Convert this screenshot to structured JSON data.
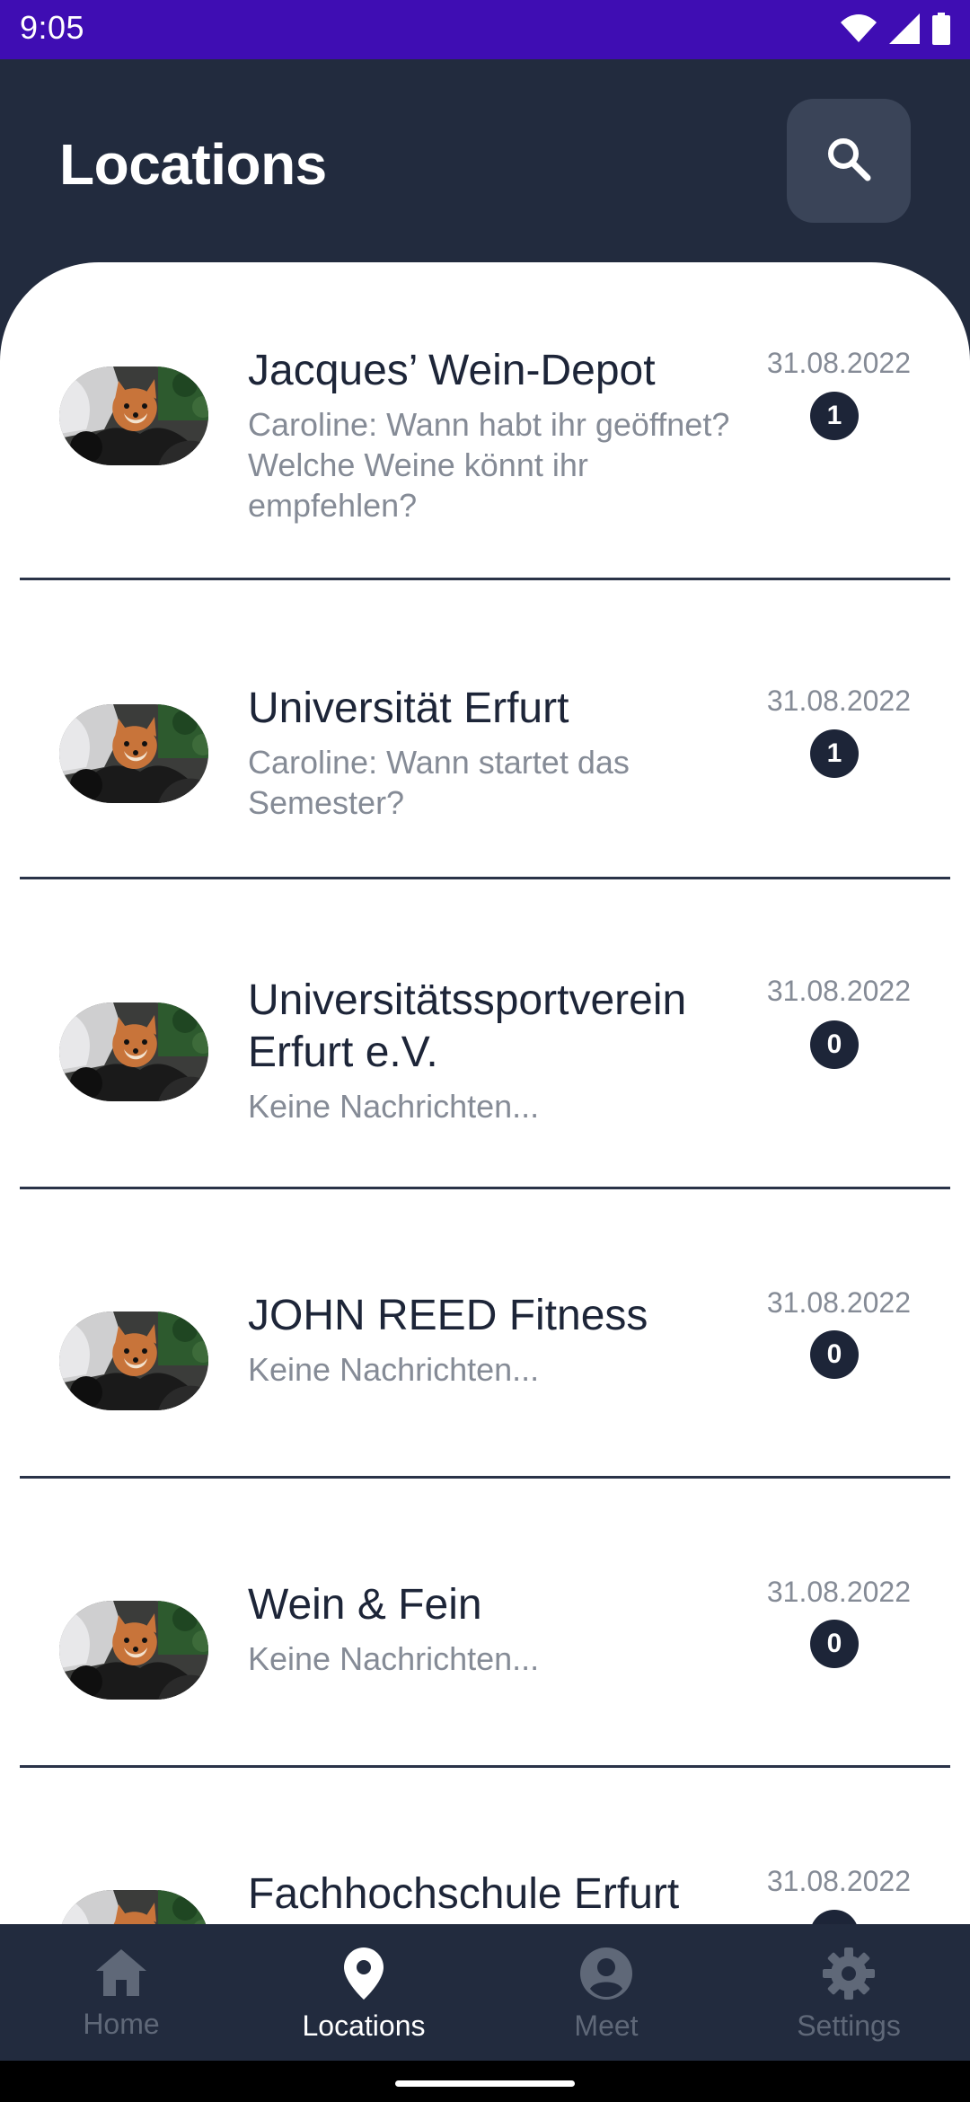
{
  "status_bar": {
    "time": "9:05",
    "icons": [
      "wifi-icon",
      "signal-icon",
      "battery-icon"
    ]
  },
  "header": {
    "title": "Locations",
    "search_icon": "search-icon"
  },
  "locations": [
    {
      "title": "Jacques’ Wein-Depot",
      "preview": "Caroline: Wann habt ihr geöffnet? Welche Weine könnt ihr empfehlen?",
      "date": "31.08.2022",
      "unread": "1"
    },
    {
      "title": "Universität Erfurt",
      "preview": "Caroline: Wann startet das Semester?",
      "date": "31.08.2022",
      "unread": "1"
    },
    {
      "title": "Universitätssportverein Erfurt e.V.",
      "preview": "Keine Nachrichten...",
      "date": "31.08.2022",
      "unread": "0"
    },
    {
      "title": "JOHN REED Fitness",
      "preview": "Keine Nachrichten...",
      "date": "31.08.2022",
      "unread": "0"
    },
    {
      "title": "Wein & Fein",
      "preview": "Keine Nachrichten...",
      "date": "31.08.2022",
      "unread": "0"
    },
    {
      "title": "Fachhochschule Erfurt",
      "date": "31.08.2022"
    }
  ],
  "bottom_nav": {
    "items": [
      {
        "label": "Home",
        "icon": "home-icon"
      },
      {
        "label": "Locations",
        "icon": "location-pin-icon",
        "active": true
      },
      {
        "label": "Meet",
        "icon": "account-circle-icon"
      },
      {
        "label": "Settings",
        "icon": "gear-icon"
      }
    ]
  },
  "colors": {
    "status_bar": "#3f0db3",
    "header_bg": "#222b3e",
    "primary_text": "#1d2538",
    "secondary_text": "#858b96",
    "nav_inactive": "#5f6878",
    "nav_active": "#ffffff"
  }
}
